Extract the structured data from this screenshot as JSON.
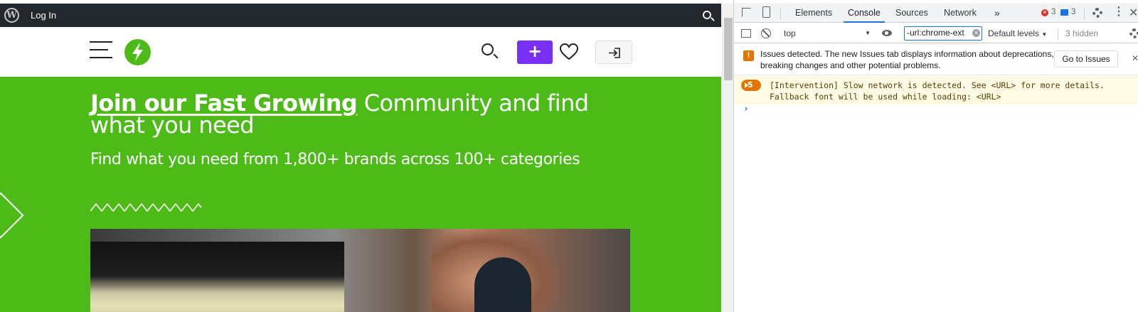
{
  "wp_admin_bar": {
    "login_label": "Log In"
  },
  "site_header": {
    "add_label": "+"
  },
  "hero": {
    "title_highlight": "Join our Fast Growing",
    "title_rest": " Community and find what you need",
    "subtitle": "Find what you need from 1,800+ brands across 100+ categories"
  },
  "devtools": {
    "tabs": [
      {
        "label": "Elements"
      },
      {
        "label": "Console",
        "active": true
      },
      {
        "label": "Sources"
      },
      {
        "label": "Network"
      }
    ],
    "more_tabs": "»",
    "error_count": "3",
    "message_count": "3",
    "context": "top",
    "filter_value": "-url:chrome-ext",
    "levels_label": "Default levels",
    "hidden_label": "3 hidden",
    "issues_text": "Issues detected. The new Issues tab displays information about deprecations, breaking changes and other potential problems.",
    "goto_issues_label": "Go to Issues",
    "warning_count": "5",
    "warning_message": "[Intervention] Slow network is detected. See <URL> for more details.\nFallback font will be used while loading: <URL>",
    "prompt": "›"
  },
  "colors": {
    "brand_green": "#4cbb17",
    "add_button_purple": "#7a2ff5",
    "devtools_accent": "#1a73e8",
    "warning_orange": "#e37400"
  }
}
